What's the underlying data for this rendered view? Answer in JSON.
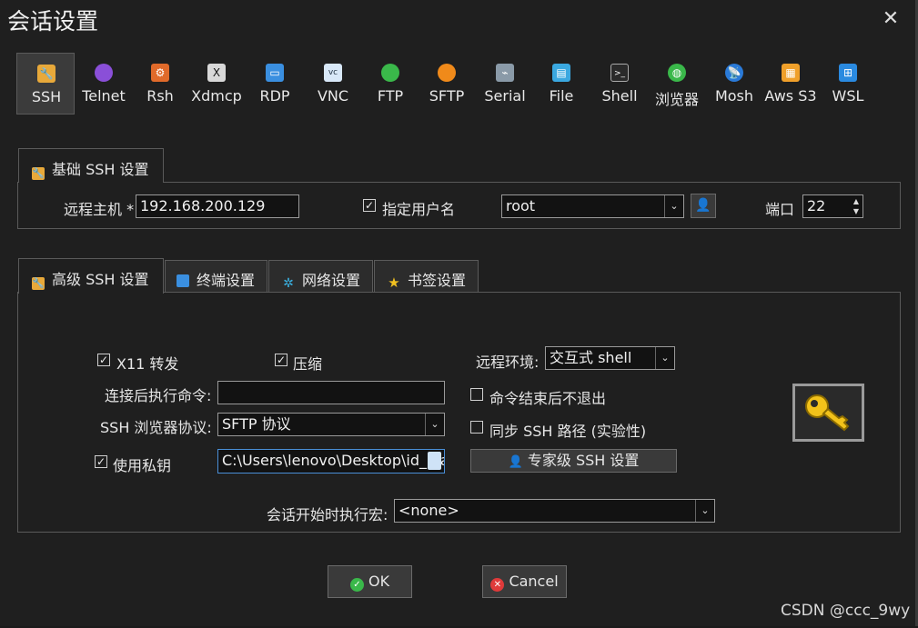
{
  "window": {
    "title": "会话设置",
    "close_glyph": "✕"
  },
  "toolbar": {
    "items": [
      {
        "label": "SSH",
        "icon": "ssh-icon",
        "color": "#e8a93a"
      },
      {
        "label": "Telnet",
        "icon": "telnet-icon",
        "color": "#8a4fd8"
      },
      {
        "label": "Rsh",
        "icon": "rsh-icon",
        "color": "#e06a2a"
      },
      {
        "label": "Xdmcp",
        "icon": "xdmcp-icon",
        "color": "#d8d8d8"
      },
      {
        "label": "RDP",
        "icon": "rdp-icon",
        "color": "#3a8fe0"
      },
      {
        "label": "VNC",
        "icon": "vnc-icon",
        "color": "#d8e8f8"
      },
      {
        "label": "FTP",
        "icon": "ftp-icon",
        "color": "#3ab84a"
      },
      {
        "label": "SFTP",
        "icon": "sftp-icon",
        "color": "#f08a1a"
      },
      {
        "label": "Serial",
        "icon": "serial-icon",
        "color": "#8a9aa8"
      },
      {
        "label": "File",
        "icon": "file-icon",
        "color": "#3aa8e0"
      },
      {
        "label": "Shell",
        "icon": "shell-icon",
        "color": "#2a2a2a"
      },
      {
        "label": "浏览器",
        "icon": "browser-icon",
        "color": "#3ab84a"
      },
      {
        "label": "Mosh",
        "icon": "mosh-icon",
        "color": "#2a7ad8"
      },
      {
        "label": "Aws S3",
        "icon": "aws-s3-icon",
        "color": "#f0a02a"
      },
      {
        "label": "WSL",
        "icon": "wsl-icon",
        "color": "#2a8ae0"
      }
    ]
  },
  "basic": {
    "tab_label": "基础 SSH 设置",
    "remote_host_label": "远程主机 *",
    "remote_host_value": "192.168.200.129",
    "specify_user_label": "指定用户名",
    "specify_user_checked": true,
    "username_value": "root",
    "port_label": "端口",
    "port_value": "22"
  },
  "advanced": {
    "tabs": [
      {
        "label": "高级 SSH 设置",
        "icon": "wrench-icon",
        "color": "#e8a93a"
      },
      {
        "label": "终端设置",
        "icon": "terminal-icon",
        "color": "#3a8fe0"
      },
      {
        "label": "网络设置",
        "icon": "network-icon",
        "color": "#3ab0e0"
      },
      {
        "label": "书签设置",
        "icon": "star-icon",
        "color": "#f0c020"
      }
    ],
    "x11_label": "X11 转发",
    "x11_checked": true,
    "compress_label": "压缩",
    "compress_checked": true,
    "remote_env_label": "远程环境:",
    "remote_env_value": "交互式 shell",
    "exec_cmd_label": "连接后执行命令:",
    "exec_cmd_value": "",
    "no_exit_label": "命令结束后不退出",
    "no_exit_checked": false,
    "browser_proto_label": "SSH 浏览器协议:",
    "browser_proto_value": "SFTP 协议",
    "sync_path_label": "同步 SSH 路径 (实验性)",
    "sync_path_checked": false,
    "private_key_label": "使用私钥",
    "private_key_checked": true,
    "private_key_value": "C:\\Users\\lenovo\\Desktop\\id_rsa",
    "expert_button_label": "专家级 SSH 设置",
    "macro_label": "会话开始时执行宏:",
    "macro_value": "<none>"
  },
  "footer": {
    "ok_label": "OK",
    "cancel_label": "Cancel"
  },
  "watermark": "CSDN @ccc_9wy"
}
